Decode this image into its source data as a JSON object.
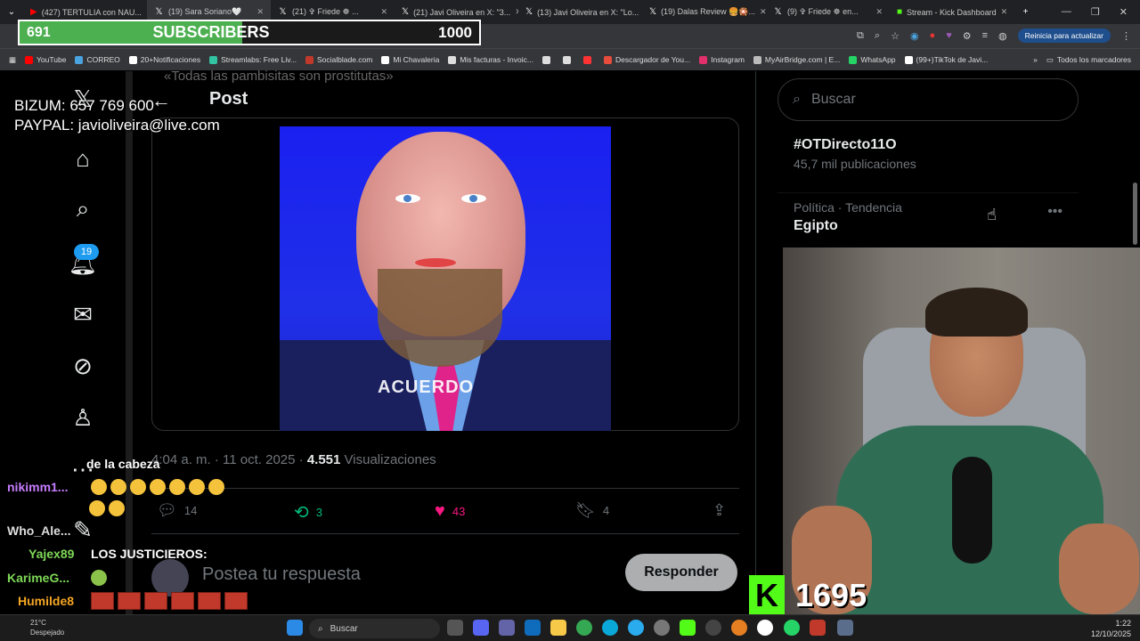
{
  "browser": {
    "tabs": [
      {
        "label": "(427) TERTULIA con NAU...",
        "icon": "youtube-icon",
        "color": "#ff0000"
      },
      {
        "label": "(19) Sara Soriano🤍",
        "icon": "x-icon",
        "color": "#ffffff",
        "active": true
      },
      {
        "label": "(21) ✞ Friede ☸ ...",
        "icon": "x-icon",
        "color": "#ffffff"
      },
      {
        "label": "(21) Javi Oliveira en X: \"3...",
        "icon": "x-icon",
        "color": "#ffffff"
      },
      {
        "label": "(13) Javi Oliveira en X: \"Lo...",
        "icon": "x-icon",
        "color": "#ffffff"
      },
      {
        "label": "(19) Dalas Review 🍔🎇...",
        "icon": "x-icon",
        "color": "#ffffff"
      },
      {
        "label": "(9) ✞ Friede ☸ en...",
        "icon": "x-icon",
        "color": "#ffffff"
      },
      {
        "label": "Stream - Kick Dashboard",
        "icon": "kick-icon",
        "color": "#53fc18"
      }
    ],
    "update_button": "Reinicia para actualizar",
    "bookmarks": [
      {
        "label": "YouTube",
        "color": "#ff0000"
      },
      {
        "label": "CORREO",
        "color": "#4aa3df"
      },
      {
        "label": "20+Notificaciones",
        "color": "#ffffff"
      },
      {
        "label": "Streamlabs: Free Liv...",
        "color": "#31c3a2"
      },
      {
        "label": "Socialblade.com",
        "color": "#c0392b"
      },
      {
        "label": "Mi Chavaleria",
        "color": "#ffffff"
      },
      {
        "label": "Mis facturas - Invoic...",
        "color": "#dddddd"
      },
      {
        "label": "",
        "color": "#dddddd"
      },
      {
        "label": "",
        "color": "#dddddd"
      },
      {
        "label": "",
        "color": "#ff3333"
      },
      {
        "label": "Descargador de You...",
        "color": "#e74c3c"
      },
      {
        "label": "Instagram",
        "color": "#e1306c"
      },
      {
        "label": "MyAirBridge.com | E...",
        "color": "#bbbbbb"
      },
      {
        "label": "WhatsApp",
        "color": "#25d366"
      },
      {
        "label": "(99+)TikTok de Javi...",
        "color": "#ffffff"
      }
    ],
    "all_bookmarks": "Todos los marcadores"
  },
  "overlay": {
    "subs_current": "691",
    "subs_label": "SUBSCRIBERS",
    "subs_goal": "1000",
    "subs_progress": 0.691,
    "donation_line1": "BIZUM: 657 769 600",
    "donation_line2": "PAYPAL: javioliveira@live.com",
    "kick_count": "1695",
    "kick_logo": "K"
  },
  "x": {
    "post_title": "Post",
    "quote_text": "«Todas las pambisitas son prostitutas»",
    "notif_count": "19",
    "image_caption": "ACUERDO",
    "meta_time": "4:04 a. m. · 11 oct. 2025 · ",
    "meta_views_num": "4.551",
    "meta_views_label": " Visualizaciones",
    "replies": "14",
    "reposts": "3",
    "likes": "43",
    "bookmarks": "4",
    "reply_placeholder": "Postea tu respuesta",
    "reply_button": "Responder",
    "search_placeholder": "Buscar",
    "trends": [
      {
        "category": "",
        "name": "#OTDirecto11O",
        "count": "45,7 mil publicaciones"
      },
      {
        "category": "Política · Tendencia",
        "name": "Egipto",
        "count": ""
      }
    ]
  },
  "chat": [
    {
      "user": "",
      "text": "de la cabeza",
      "user_color": "#ffffff"
    },
    {
      "user": "nikimm1...",
      "text": "",
      "user_color": "#c77dff"
    },
    {
      "user": "Who_Ale...",
      "text": "",
      "user_color": "#dddddd"
    },
    {
      "user": "Yajex89",
      "text": "LOS JUSTICIEROS:",
      "user_color": "#7ed957"
    },
    {
      "user": "KarimeG...",
      "text": "",
      "user_color": "#7ed957"
    },
    {
      "user": "Humilde8",
      "text": "",
      "user_color": "#f5a623"
    }
  ],
  "taskbar": {
    "search": "Buscar",
    "weather_temp": "21°C",
    "weather_desc": "Despejado",
    "time": "1:22",
    "date": "12/10/2025"
  }
}
